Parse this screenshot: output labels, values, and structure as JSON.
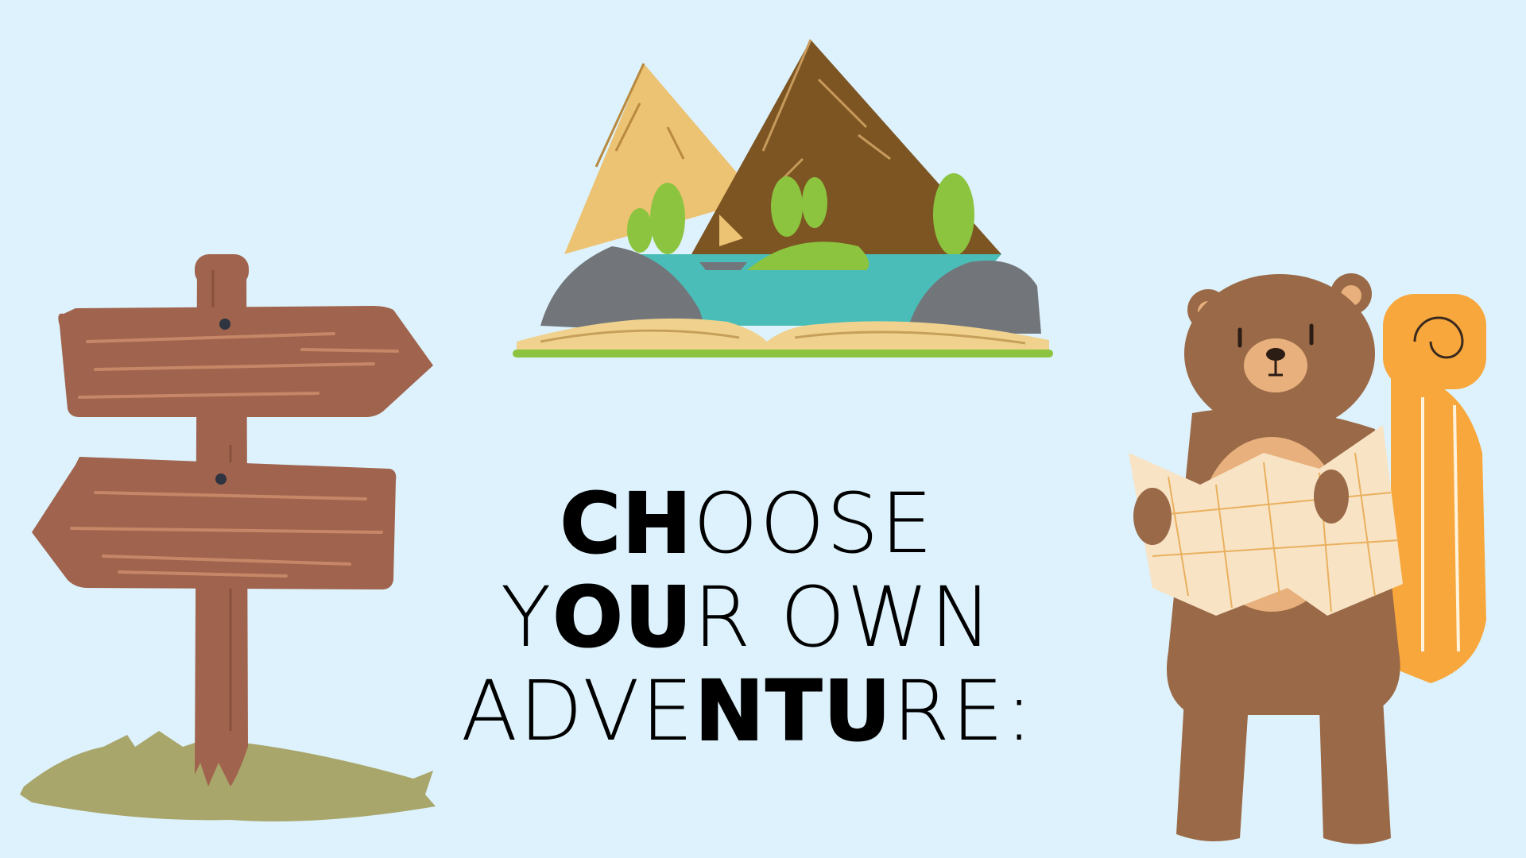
{
  "title": {
    "line1": [
      "CH",
      "OOSE"
    ],
    "line2": [
      "Y",
      "OU",
      "R OWN"
    ],
    "line3": [
      "ADVE",
      "NTU",
      "RE:"
    ]
  },
  "colors": {
    "background": "#ddf2fc",
    "sign_wood": "#a0634d",
    "grass": "#a9a66c",
    "mountain_light": "#ecc273",
    "mountain_dark": "#7c5523",
    "water": "#4bbdb8",
    "rock": "#72767b",
    "tree_green": "#8cc43f",
    "book_page": "#f0d28e",
    "bear_fur": "#9a6947",
    "backpack": "#f7a73c",
    "map_paper": "#f8e3c5"
  },
  "icons": [
    "signpost-icon",
    "open-book-mountains-icon",
    "bear-with-map-icon"
  ]
}
